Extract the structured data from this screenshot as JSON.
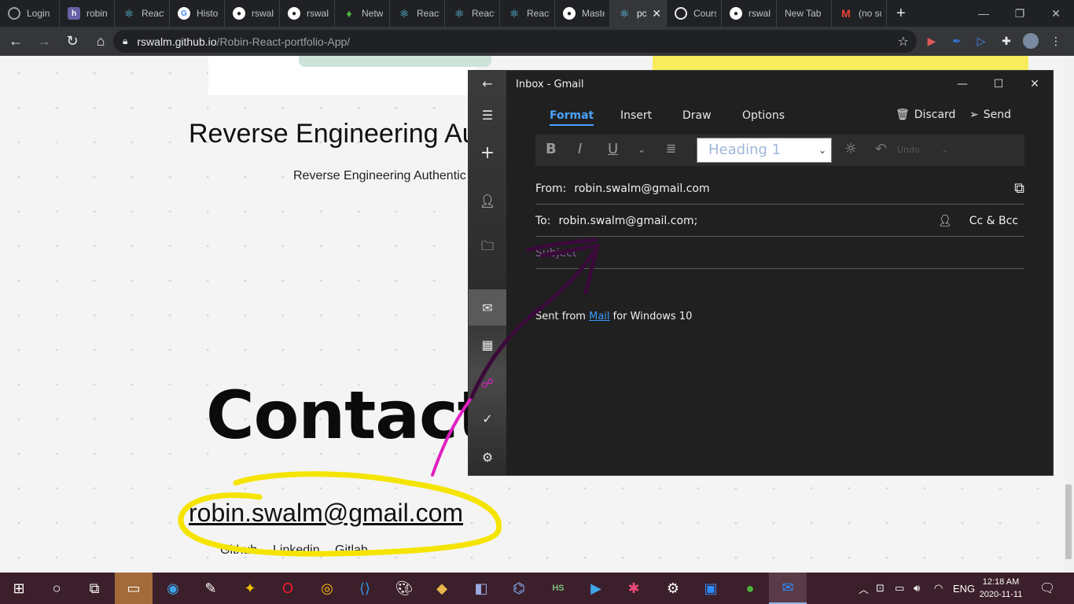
{
  "browser": {
    "tabs": [
      {
        "label": "Login",
        "icon": "chrome-globe-icon",
        "color": "#5f6368"
      },
      {
        "label": "robin",
        "icon": "heroku-icon",
        "color": "#6762a6"
      },
      {
        "label": "React",
        "icon": "react-icon",
        "color": "#61dafb"
      },
      {
        "label": "Histo",
        "icon": "google-icon",
        "color": "#4285f4"
      },
      {
        "label": "rswal",
        "icon": "github-icon",
        "color": "#ffffff"
      },
      {
        "label": "rswal",
        "icon": "github-icon",
        "color": "#ffffff"
      },
      {
        "label": "Netw",
        "icon": "mongodb-leaf-icon",
        "color": "#4db33d"
      },
      {
        "label": "React",
        "icon": "react-icon",
        "color": "#61dafb"
      },
      {
        "label": "React",
        "icon": "react-icon",
        "color": "#61dafb"
      },
      {
        "label": "React",
        "icon": "react-icon",
        "color": "#61dafb"
      },
      {
        "label": "Maste",
        "icon": "github-icon",
        "color": "#ffffff"
      },
      {
        "label": "pc",
        "icon": "react-icon",
        "color": "#61dafb",
        "active": true
      },
      {
        "label": "Cours",
        "icon": "chrome-globe-icon",
        "color": "#e8eaed"
      },
      {
        "label": "rswal",
        "icon": "github-icon",
        "color": "#ffffff"
      },
      {
        "label": "New Tab",
        "icon": "",
        "color": ""
      },
      {
        "label": "(no su",
        "icon": "gmail-icon",
        "color": "#ea4335"
      }
    ],
    "url_host": "rswalm.github.io",
    "url_path": "/Robin-React-portfolio-App/"
  },
  "page": {
    "project_title": "Reverse Engineering Aut",
    "project_desc": "Reverse Engineering Authentic",
    "contact_heading": "Contact",
    "email": "robin.swalm@gmail.com",
    "links": [
      "Github",
      "Linkedin",
      "Gitlab"
    ]
  },
  "mail": {
    "window_title": "Inbox - Gmail",
    "ribbon_tabs": [
      "Format",
      "Insert",
      "Draw",
      "Options"
    ],
    "discard_label": "Discard",
    "send_label": "Send",
    "format_buttons": {
      "bold": "B",
      "italic": "I",
      "underline": "U"
    },
    "heading_value": "Heading 1",
    "undo_label": "Undo",
    "from_label": "From:",
    "from_value": "robin.swalm@gmail.com",
    "to_label": "To:",
    "to_value": "robin.swalm@gmail.com;",
    "cc_label": "Cc & Bcc",
    "subject_placeholder": "Subject",
    "signature_prefix": "Sent from ",
    "signature_link": "Mail",
    "signature_suffix": " for Windows 10"
  },
  "taskbar": {
    "lang": "ENG",
    "time": "12:18 AM",
    "date": "2020-11-11"
  },
  "colors": {
    "accent_blue": "#4aa3ff",
    "annotation_yellow": "#f5e400",
    "annotation_magenta": "#e020c0",
    "annotation_purple": "#3a0a3a"
  }
}
